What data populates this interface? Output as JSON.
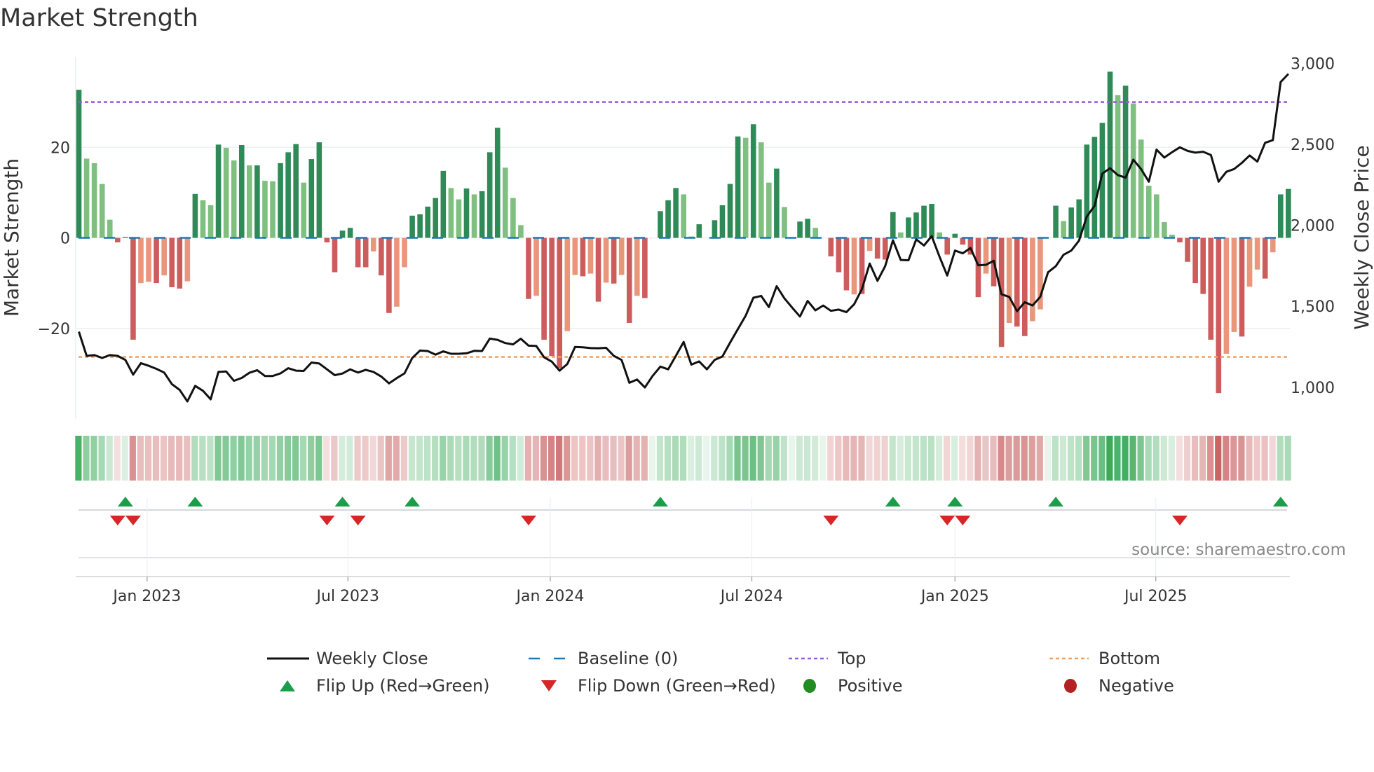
{
  "chart_data": {
    "type": "bar+line",
    "title": "Market Strength",
    "ylabel_left": "Market Strength",
    "ylabel_right": "Weekly Close Price",
    "ylim_left": [
      -40,
      40
    ],
    "ylim_right": [
      805,
      3040
    ],
    "left_ticks": [
      {
        "label": "20",
        "value": 20
      },
      {
        "label": "0",
        "value": 0
      },
      {
        "label": "−20",
        "value": -20
      }
    ],
    "right_ticks": [
      {
        "label": "3,000",
        "value": 3000
      },
      {
        "label": "2,500",
        "value": 2500
      },
      {
        "label": "2,000",
        "value": 2000
      },
      {
        "label": "1,500",
        "value": 1500
      },
      {
        "label": "1,000",
        "value": 1000
      }
    ],
    "x_ticks": [
      {
        "label": "Jan 2023",
        "week": 8.8
      },
      {
        "label": "Jul 2023",
        "week": 34.7
      },
      {
        "label": "Jan 2024",
        "week": 60.8
      },
      {
        "label": "Jul 2024",
        "week": 86.8
      },
      {
        "label": "Jan 2025",
        "week": 113.0
      },
      {
        "label": "Jul 2025",
        "week": 138.9
      }
    ],
    "top_level": 30,
    "bottom_level": -26.3,
    "baseline": 0,
    "strength": [
      32.7,
      17.5,
      16.5,
      11.9,
      4.0,
      -1.0,
      0.2,
      -22.5,
      -10.0,
      -9.7,
      -10.0,
      -8.3,
      -10.9,
      -11.2,
      -9.6,
      9.7,
      8.3,
      7.2,
      20.6,
      19.9,
      17.1,
      20.5,
      16.0,
      16.0,
      12.6,
      12.5,
      16.5,
      18.9,
      20.7,
      12.2,
      17.4,
      21.1,
      -1.0,
      -7.6,
      1.6,
      2.2,
      -6.5,
      -6.5,
      -3.0,
      -8.3,
      -16.6,
      -15.2,
      -6.5,
      4.9,
      5.2,
      6.9,
      8.8,
      14.8,
      11.0,
      8.5,
      10.9,
      9.6,
      10.3,
      18.9,
      24.3,
      15.5,
      8.8,
      2.8,
      -13.5,
      -12.8,
      -22.5,
      -26.1,
      -28.8,
      -20.6,
      -8.2,
      -8.5,
      -7.9,
      -14.1,
      -9.9,
      -10.1,
      -8.2,
      -18.8,
      -12.8,
      -13.3,
      0,
      5.9,
      8.3,
      11.0,
      9.6,
      0.3,
      3.0,
      0,
      3.9,
      7.2,
      11.9,
      22.4,
      22.1,
      25.1,
      21.1,
      12.2,
      15.3,
      6.8,
      0,
      3.6,
      4.2,
      2.2,
      0,
      -4.1,
      -7.6,
      -11.6,
      -12.5,
      -12.4,
      -2.9,
      -4.6,
      -4.8,
      5.7,
      1.2,
      4.5,
      5.6,
      7.1,
      7.5,
      1.2,
      -3.7,
      0.9,
      -1.5,
      -3.7,
      -13.1,
      -7.9,
      -10.7,
      -24.1,
      -18.8,
      -19.6,
      -21.7,
      -18.4,
      -15.8,
      0,
      7.1,
      3.7,
      6.7,
      8.5,
      20.6,
      22.3,
      25.4,
      36.7,
      31.5,
      33.6,
      29.7,
      21.7,
      11.5,
      9.6,
      3.5,
      0.7,
      -1.0,
      -5.3,
      -10.0,
      -12.4,
      -22.5,
      -34.3,
      -25.6,
      -20.8,
      -21.8,
      -10.8,
      -7.0,
      -9.0,
      -3.2,
      9.6,
      10.8
    ],
    "strength_shade": "DLLLLDDDLLDLDDLDLLDLLDLDLLDDDLDDDDDDDDLDDLLDDDDDLLDLDDDLLLDLDDDLLDLDLDLDLDDDDDLLDDDDDDLDLLDLDDDLDDDDLDLDDDLDDDDLDDDDDLDDLDDLLDDLDDDDDDLDLLLLLLDDDDDDLLDLLDLDD",
    "weekly_close": [
      1343,
      1194,
      1199,
      1181,
      1199,
      1194,
      1169,
      1078,
      1149,
      1133,
      1114,
      1091,
      1020,
      984,
      913,
      1009,
      979,
      926,
      1095,
      1098,
      1040,
      1058,
      1090,
      1106,
      1070,
      1070,
      1086,
      1118,
      1103,
      1101,
      1153,
      1147,
      1111,
      1075,
      1085,
      1111,
      1091,
      1108,
      1095,
      1067,
      1024,
      1057,
      1086,
      1181,
      1227,
      1224,
      1202,
      1222,
      1207,
      1207,
      1210,
      1225,
      1224,
      1301,
      1293,
      1273,
      1265,
      1300,
      1257,
      1255,
      1186,
      1158,
      1103,
      1144,
      1249,
      1247,
      1242,
      1241,
      1244,
      1194,
      1169,
      1028,
      1048,
      999,
      1070,
      1128,
      1111,
      1194,
      1280,
      1140,
      1160,
      1111,
      1169,
      1190,
      1276,
      1359,
      1442,
      1553,
      1564,
      1495,
      1624,
      1549,
      1492,
      1437,
      1533,
      1475,
      1505,
      1472,
      1480,
      1464,
      1513,
      1607,
      1764,
      1657,
      1748,
      1908,
      1786,
      1784,
      1913,
      1875,
      1933,
      1806,
      1690,
      1844,
      1827,
      1860,
      1753,
      1756,
      1781,
      1574,
      1558,
      1470,
      1525,
      1505,
      1558,
      1710,
      1748,
      1818,
      1844,
      1905,
      2054,
      2120,
      2319,
      2352,
      2310,
      2294,
      2405,
      2347,
      2269,
      2467,
      2418,
      2451,
      2481,
      2459,
      2448,
      2454,
      2434,
      2269,
      2330,
      2347,
      2385,
      2431,
      2393,
      2509,
      2525,
      2884,
      2934
    ],
    "flip_up_weeks": [
      7,
      16,
      35,
      44,
      76,
      106,
      114,
      127,
      156
    ],
    "flip_down_weeks": [
      6,
      8,
      33,
      37,
      59,
      98,
      113,
      115,
      143
    ],
    "legend": [
      {
        "label": "Weekly Close",
        "kind": "line"
      },
      {
        "label": "Baseline (0)",
        "kind": "dash"
      },
      {
        "label": "Top",
        "kind": "dot-top"
      },
      {
        "label": "Bottom",
        "kind": "dot-bottom"
      },
      {
        "label": "Flip Up (Red→Green)",
        "kind": "up"
      },
      {
        "label": "Flip Down (Green→Red)",
        "kind": "down"
      },
      {
        "label": "Positive",
        "kind": "pos"
      },
      {
        "label": "Negative",
        "kind": "neg"
      }
    ],
    "legend_placement": "bottom-center",
    "source": "source: sharemaestro.com",
    "colors": {
      "pos_dark": "#2e8b57",
      "pos_light": "#7fbf7f",
      "neg_dark": "#cd5c5c",
      "neg_light": "#e9967a",
      "line": "#111111",
      "baseline": "#1f77b4",
      "top": "#9b59d6",
      "bottom": "#f0a060",
      "flip_up": "#1a9e4a",
      "flip_down": "#d62728",
      "positive": "#228b22",
      "negative": "#b22222"
    }
  }
}
